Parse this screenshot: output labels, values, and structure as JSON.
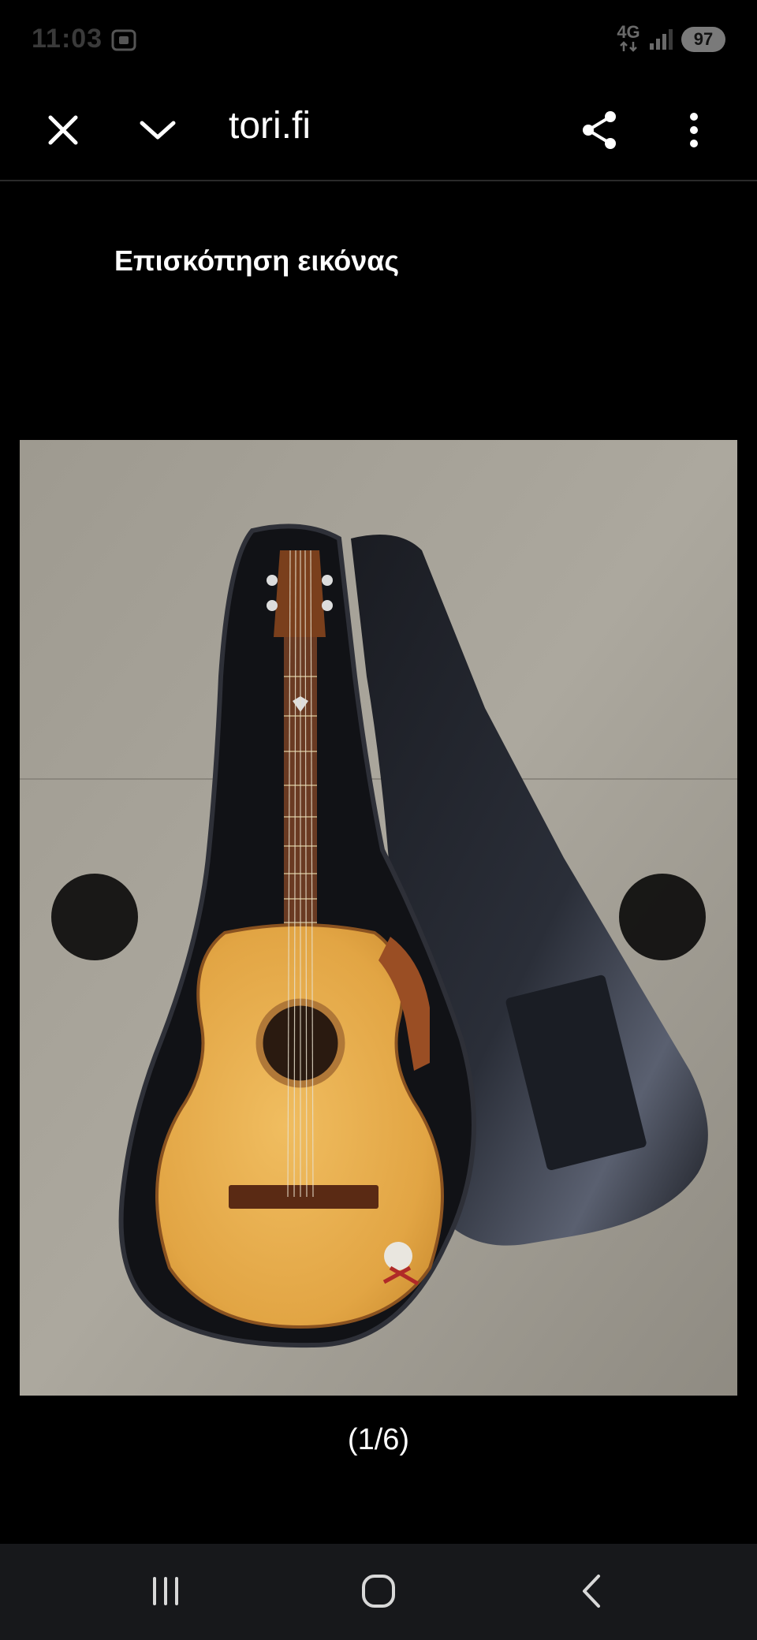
{
  "status_bar": {
    "time": "11:03",
    "network": "4G",
    "battery": "97",
    "icons": [
      "screenshot-icon",
      "data-transfer-icon",
      "signal-icon"
    ]
  },
  "app_bar": {
    "title": "tori.fi",
    "icons": [
      "close-icon",
      "chevron-down-icon",
      "share-icon",
      "more-vert-icon"
    ]
  },
  "content": {
    "heading": "Επισκόπηση εικόνας",
    "image_subject": "guitar-in-gig-bag-photo",
    "counter": "(1/6)"
  },
  "system_nav": {
    "icons": [
      "recents-icon",
      "home-icon",
      "back-icon"
    ]
  },
  "colors": {
    "background": "#000000",
    "nav_bar": "#17181b",
    "text": "#ffffff"
  }
}
